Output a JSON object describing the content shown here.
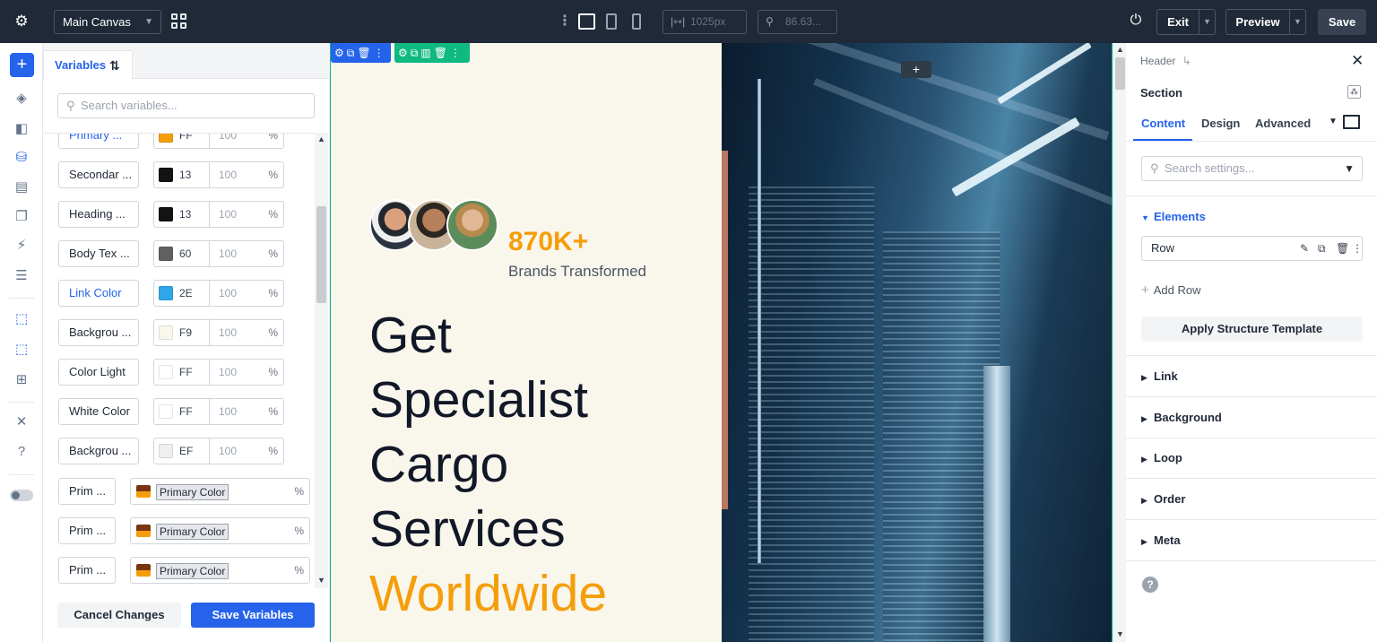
{
  "topbar": {
    "canvas_select": "Main Canvas",
    "width_value": "1025px",
    "zoom_value": "86.63...",
    "exit_label": "Exit",
    "preview_label": "Preview",
    "save_label": "Save"
  },
  "variables_panel": {
    "tab_label": "Variables",
    "search_placeholder": "Search variables...",
    "color_vars": [
      {
        "name": "Primary ...",
        "color": "#F59E0B",
        "hex": "FF",
        "opacity": "100",
        "pct": "%",
        "name_blue": true
      },
      {
        "name": "Secondar ...",
        "color": "#131313",
        "hex": "13",
        "opacity": "100",
        "pct": "%",
        "name_blue": false
      },
      {
        "name": "Heading ...",
        "color": "#131313",
        "hex": "13",
        "opacity": "100",
        "pct": "%",
        "name_blue": false
      },
      {
        "name": "Body Tex ...",
        "color": "#606060",
        "hex": "60",
        "opacity": "100",
        "pct": "%",
        "name_blue": false
      },
      {
        "name": "Link Color",
        "color": "#2EA6E8",
        "hex": "2E",
        "opacity": "100",
        "pct": "%",
        "name_blue": true
      },
      {
        "name": "Backgrou ...",
        "color": "#F9F6EC",
        "hex": "F9",
        "opacity": "100",
        "pct": "%",
        "name_blue": false
      },
      {
        "name": "Color Light",
        "color": "#FFFFFF",
        "hex": "FF",
        "opacity": "100",
        "pct": "%",
        "name_blue": false
      },
      {
        "name": "White Color",
        "color": "#FFFFFF",
        "hex": "FF",
        "opacity": "100",
        "pct": "%",
        "name_blue": false
      },
      {
        "name": "Backgrou ...",
        "color": "#EFEFEF",
        "hex": "EF",
        "opacity": "100",
        "pct": "%",
        "name_blue": false
      }
    ],
    "linked_vars": [
      {
        "name": "Prim ...",
        "value": "Primary Color",
        "pct": "%"
      },
      {
        "name": "Prim ...",
        "value": "Primary Color",
        "pct": "%"
      },
      {
        "name": "Prim ...",
        "value": "Primary Color",
        "pct": "%"
      }
    ],
    "cancel_label": "Cancel Changes",
    "save_label": "Save Variables"
  },
  "canvas": {
    "stat_value": "870K+",
    "stat_label": "Brands Transformed",
    "hero_lines": [
      "Get",
      "Specialist",
      "Cargo",
      "Services"
    ],
    "hero_accent": "Worldwide",
    "add_label": "+"
  },
  "settings_panel": {
    "breadcrumb": "Header",
    "title": "Section",
    "tabs": [
      "Content",
      "Design",
      "Advanced"
    ],
    "search_placeholder": "Search settings...",
    "elements_label": "Elements",
    "row_label": "Row",
    "add_row_label": "Add Row",
    "apply_template_label": "Apply Structure Template",
    "sections": [
      "Link",
      "Background",
      "Loop",
      "Order",
      "Meta"
    ]
  },
  "colors": {
    "accent": "#2563eb",
    "brand_orange": "#f59e0b",
    "module_green": "#10b981",
    "topbar": "#1f2937"
  }
}
